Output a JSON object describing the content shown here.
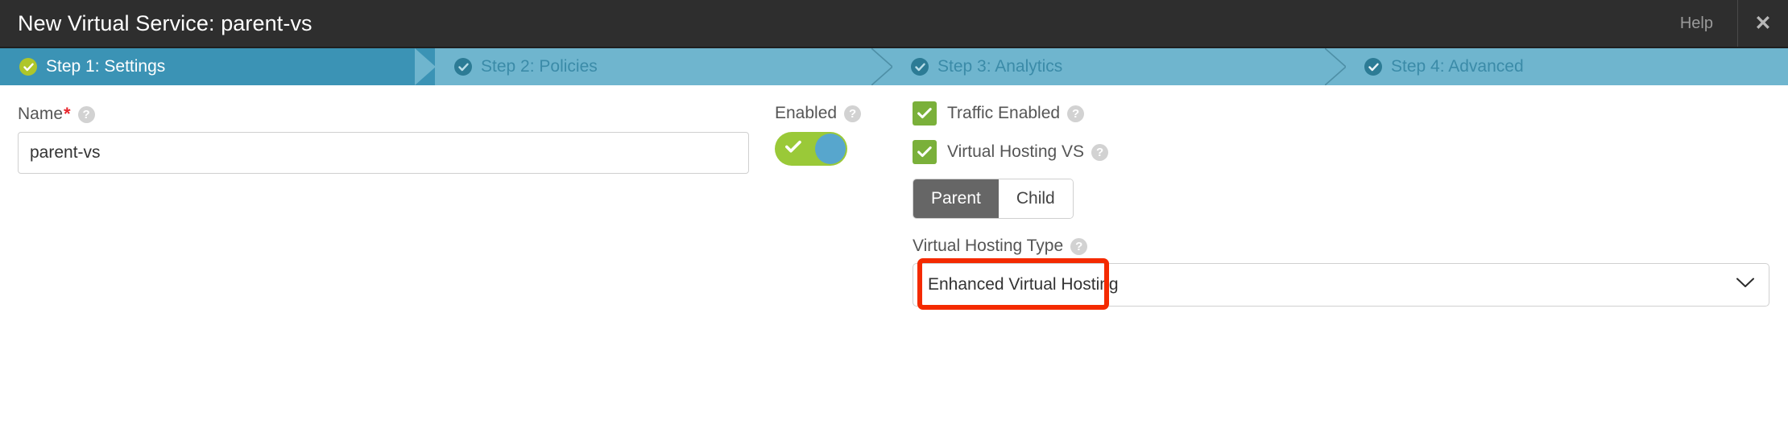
{
  "window": {
    "title": "New Virtual Service: parent-vs",
    "help_label": "Help",
    "close_icon": "close-icon"
  },
  "wizard": {
    "steps": [
      {
        "label": "Step 1: Settings",
        "active": true,
        "icon": "check-circle-icon"
      },
      {
        "label": "Step 2: Policies",
        "active": false,
        "icon": "check-circle-icon"
      },
      {
        "label": "Step 3: Analytics",
        "active": false,
        "icon": "check-circle-icon"
      },
      {
        "label": "Step 4: Advanced",
        "active": false,
        "icon": "check-circle-icon"
      }
    ]
  },
  "form": {
    "name": {
      "label": "Name",
      "required_marker": "*",
      "help_icon": "?",
      "value": "parent-vs",
      "placeholder": ""
    },
    "enabled": {
      "label": "Enabled",
      "help_icon": "?",
      "toggle_state": "on"
    },
    "traffic_enabled": {
      "label": "Traffic Enabled",
      "help_icon": "?",
      "checked": true
    },
    "virtual_hosting_vs": {
      "label": "Virtual Hosting VS",
      "help_icon": "?",
      "checked": true
    },
    "vs_role": {
      "options": [
        {
          "label": "Parent",
          "selected": true
        },
        {
          "label": "Child",
          "selected": false
        }
      ]
    },
    "virtual_hosting_type": {
      "label": "Virtual Hosting Type",
      "help_icon": "?",
      "selected": "Enhanced Virtual Hosting",
      "chevron_icon": "chevron-down-icon",
      "highlighted": true
    }
  },
  "colors": {
    "titlebar_bg": "#2e2e2e",
    "step_active_bg": "#3b93b5",
    "step_inactive_bg": "#6fb5ce",
    "step_active_check": "#aec62a",
    "toggle_on": "#9ac938",
    "toggle_knob": "#57a6cd",
    "checkbox_green": "#7ab03a",
    "required_red": "#e8262d",
    "highlight_red": "#f42a00",
    "segment_selected": "#666666"
  }
}
